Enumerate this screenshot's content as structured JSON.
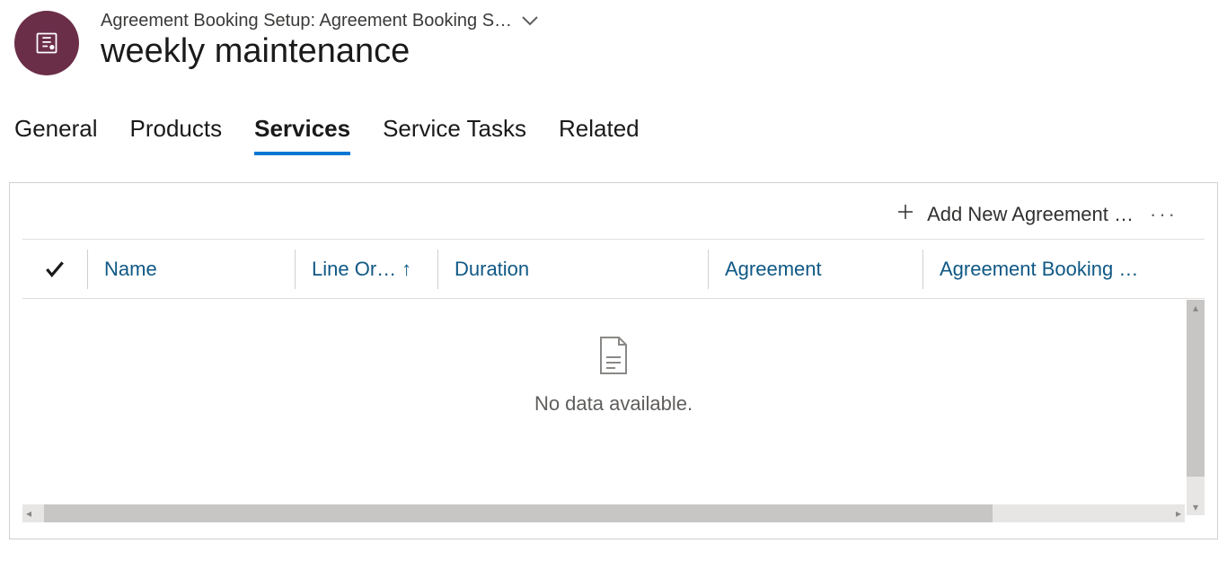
{
  "header": {
    "breadcrumb": "Agreement Booking Setup: Agreement Booking S…",
    "title": "weekly maintenance"
  },
  "tabs": {
    "general": "General",
    "products": "Products",
    "services": "Services",
    "service_tasks": "Service Tasks",
    "related": "Related",
    "selected": "services"
  },
  "grid": {
    "toolbar": {
      "add_new_label": "Add New Agreement …"
    },
    "columns": {
      "name": "Name",
      "line_order": "Line Or…",
      "duration": "Duration",
      "agreement": "Agreement",
      "agreement_booking": "Agreement Booking S…"
    },
    "empty_message": "No data available.",
    "rows": []
  },
  "colors": {
    "entity_bg": "#6b2e49",
    "link": "#0f5885",
    "accent": "#0078d4"
  }
}
